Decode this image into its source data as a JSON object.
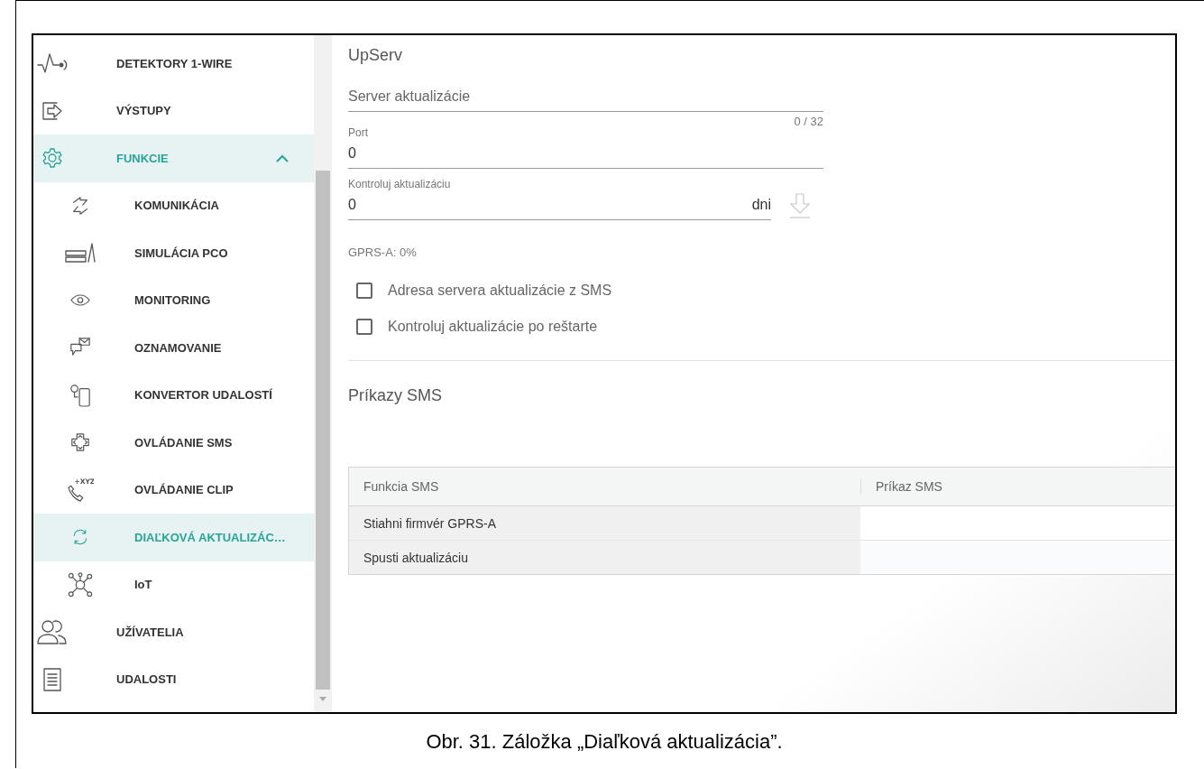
{
  "sidebar": {
    "items": [
      {
        "label": "DETEKTORY 1-WIRE",
        "selected": false
      },
      {
        "label": "VÝSTUPY",
        "selected": false
      },
      {
        "label": "FUNKCIE",
        "selected": true,
        "expanded": true,
        "children": [
          {
            "label": "KOMUNIKÁCIA",
            "selected": false
          },
          {
            "label": "SIMULÁCIA PCO",
            "selected": false
          },
          {
            "label": "MONITORING",
            "selected": false
          },
          {
            "label": "OZNAMOVANIE",
            "selected": false
          },
          {
            "label": "KONVERTOR UDALOSTÍ",
            "selected": false
          },
          {
            "label": "OVLÁDANIE SMS",
            "selected": false
          },
          {
            "label": "OVLÁDANIE CLIP",
            "selected": false,
            "icon_text": "+XYZ"
          },
          {
            "label": "DIAĽKOVÁ AKTUALIZÁC…",
            "selected": true
          },
          {
            "label": "IoT",
            "selected": false
          }
        ]
      },
      {
        "label": "UŽÍVATELIA",
        "selected": false
      },
      {
        "label": "UDALOSTI",
        "selected": false
      }
    ]
  },
  "main": {
    "title": "UpServ",
    "fields": [
      {
        "kind": "text",
        "placeholder": "Server aktualizácie",
        "counter": "0 / 32"
      },
      {
        "kind": "text",
        "label": "Port",
        "value": "0"
      },
      {
        "kind": "unit",
        "label": "Kontroluj aktualizáciu",
        "value": "0",
        "unit": "dni",
        "action_disabled": true
      }
    ],
    "status": "GPRS-A: 0%",
    "checkboxes": [
      {
        "label": "Adresa servera aktualizácie z SMS",
        "checked": false
      },
      {
        "label": "Kontroluj aktualizácie po reštarte",
        "checked": false
      }
    ],
    "sms_title": "Príkazy SMS",
    "table": {
      "columns": [
        "Funkcia SMS",
        "Príkaz SMS"
      ],
      "rows": [
        [
          "Stiahni firmvér GPRS-A"
        ],
        [
          "Spusti aktualizáciu"
        ]
      ]
    }
  },
  "caption": "Obr. 31. Záložka „Diaľková aktualizácia”."
}
